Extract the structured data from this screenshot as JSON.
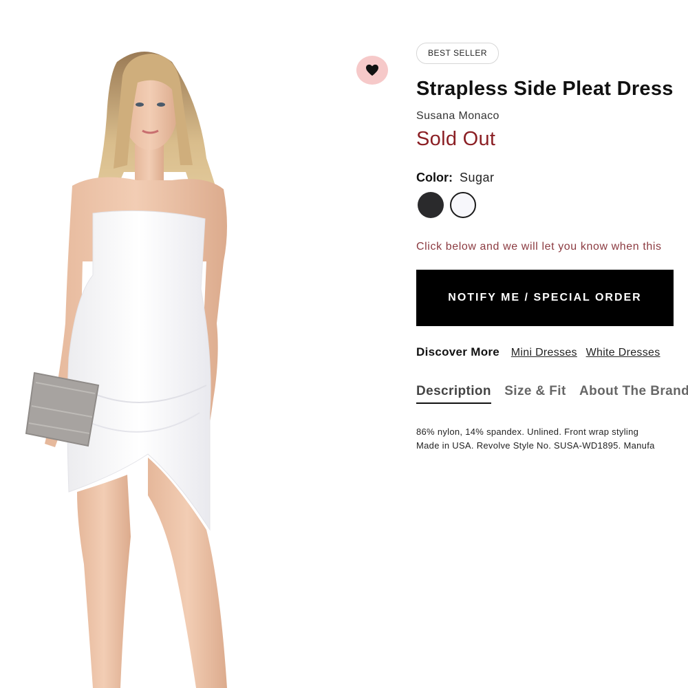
{
  "product": {
    "badge": "BEST SELLER",
    "title": "Strapless Side Pleat Dress",
    "brand": "Susana Monaco",
    "status": "Sold Out",
    "status_color": "#8b1f24"
  },
  "color": {
    "label": "Color:",
    "selected": "Sugar",
    "swatches": [
      {
        "hex": "#2a2a2c"
      },
      {
        "hex": "#f7f7fb",
        "selected": true
      }
    ]
  },
  "notify": {
    "message": "Click below and we will let you know when this",
    "button_label": "NOTIFY ME / SPECIAL ORDER"
  },
  "discover": {
    "label": "Discover More",
    "links": [
      "Mini Dresses",
      "White Dresses"
    ]
  },
  "tabs": [
    "Description",
    "Size & Fit",
    "About The Brand"
  ],
  "description": {
    "line1": "86% nylon, 14% spandex. Unlined. Front wrap styling",
    "line2": "Made in USA. Revolve Style No. SUSA-WD1895. Manufa"
  },
  "icons": {
    "wishlist": "heart-icon"
  }
}
